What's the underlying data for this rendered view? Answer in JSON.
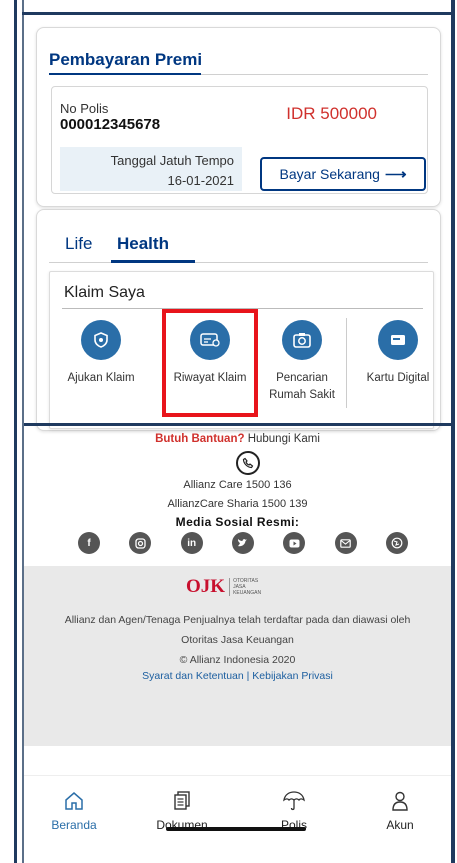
{
  "premi": {
    "title": "Pembayaran Premi",
    "polis_label": "No Polis",
    "polis_number": "000012345678",
    "amount": "IDR 500000",
    "due_label": "Tanggal Jatuh Tempo",
    "due_date": "16-01-2021",
    "pay_button": "Bayar Sekarang",
    "pay_arrow": "⟶"
  },
  "tabs": [
    {
      "label": "Life",
      "active": false
    },
    {
      "label": "Health",
      "active": true
    }
  ],
  "klaim": {
    "title": "Klaim Saya",
    "items": [
      {
        "label": "Ajukan Klaim",
        "icon": "shield-icon"
      },
      {
        "label": "Riwayat Klaim",
        "icon": "card-history-icon"
      },
      {
        "label": "Pencarian Rumah Sakit",
        "icon": "hospital-search-icon"
      },
      {
        "label": "Kartu Digital",
        "icon": "digital-card-icon"
      }
    ]
  },
  "footer": {
    "help_strong": "Butuh Bantuan?",
    "help_rest": " Hubungi Kami",
    "care1": "Allianz Care 1500 136",
    "care2": "AllianzCare Sharia 1500 139",
    "media_title": "Media Sosial Resmi:",
    "social": [
      "facebook-icon",
      "instagram-icon",
      "linkedin-icon",
      "twitter-icon",
      "youtube-icon",
      "email-icon",
      "website-icon"
    ],
    "ojk_mark": "OJK",
    "ojk_sub": "OTORITAS\nJASA\nKEUANGAN",
    "ojk_text1": "Allianz dan Agen/Tenaga Penjualnya telah terdaftar pada dan diawasi oleh",
    "ojk_text2": "Otoritas Jasa Keuangan",
    "ojk_text3": "© Allianz Indonesia 2020",
    "links": "Syarat dan Ketentuan | Kebijakan Privasi"
  },
  "nav": [
    {
      "label": "Beranda",
      "icon": "home-icon",
      "active": true
    },
    {
      "label": "Dokumen",
      "icon": "document-icon",
      "active": false
    },
    {
      "label": "Polis",
      "icon": "umbrella-icon",
      "active": false
    },
    {
      "label": "Akun",
      "icon": "user-icon",
      "active": false
    }
  ],
  "colors": {
    "primary": "#003781",
    "accent": "#2a6ea8",
    "amount": "#d0312d",
    "highlight": "#e8141b"
  }
}
